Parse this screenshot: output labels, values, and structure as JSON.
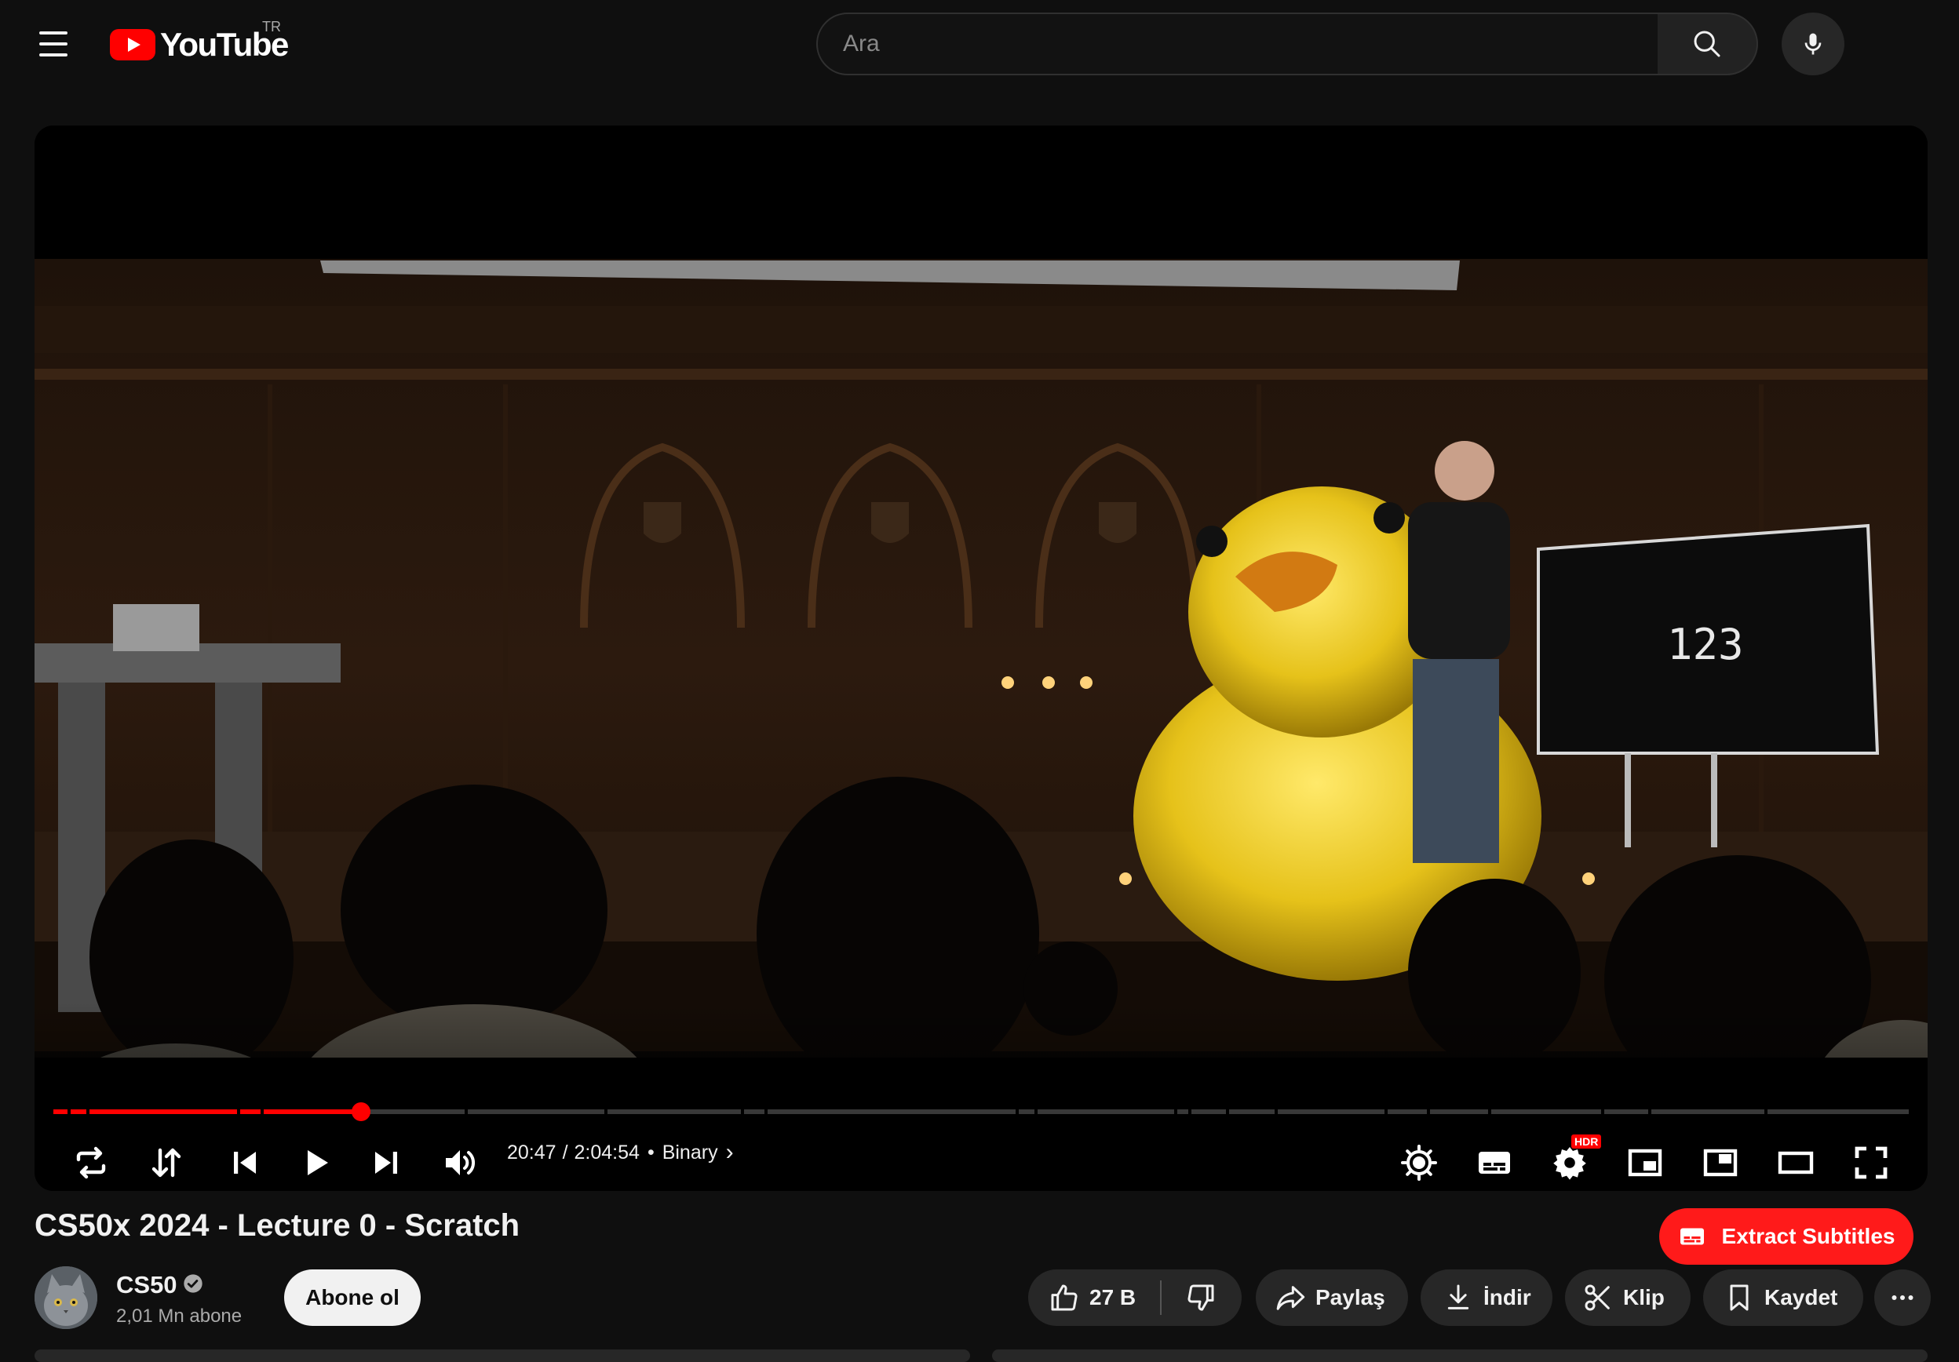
{
  "header": {
    "logo_text": "YouTube",
    "country_code": "TR",
    "search_placeholder": "Ara",
    "icons": [
      "menu-icon",
      "youtube-logo-icon",
      "search-icon",
      "microphone-icon"
    ]
  },
  "player": {
    "current_time": "20:47",
    "separator": "/",
    "duration": "2:04:54",
    "chapter_separator": "•",
    "chapter": "Binary",
    "progress_fraction": 0.166,
    "screen_text": "123",
    "controls": [
      "loop-icon",
      "sort-icon",
      "previous-icon",
      "play-icon",
      "next-icon",
      "volume-icon",
      "ambient-mode-icon",
      "subtitles-icon",
      "settings-icon",
      "miniplayer-icon",
      "picture-in-picture-icon",
      "theater-mode-icon",
      "fullscreen-icon"
    ],
    "settings_badge": "HDR"
  },
  "video": {
    "title": "CS50x 2024 - Lecture 0 - Scratch"
  },
  "channel": {
    "name": "CS50",
    "subscribers": "2,01 Mn abone",
    "subscribe_label": "Abone ol"
  },
  "actions": {
    "extract_label": "Extract Subtitles",
    "likes": "27 B",
    "share_label": "Paylaş",
    "download_label": "İndir",
    "clip_label": "Klip",
    "save_label": "Kaydet"
  },
  "colors": {
    "background": "#0f0f0f",
    "accent_red": "#ff0000",
    "pill_bg": "#272727",
    "extract_red": "#ff1a1a"
  }
}
